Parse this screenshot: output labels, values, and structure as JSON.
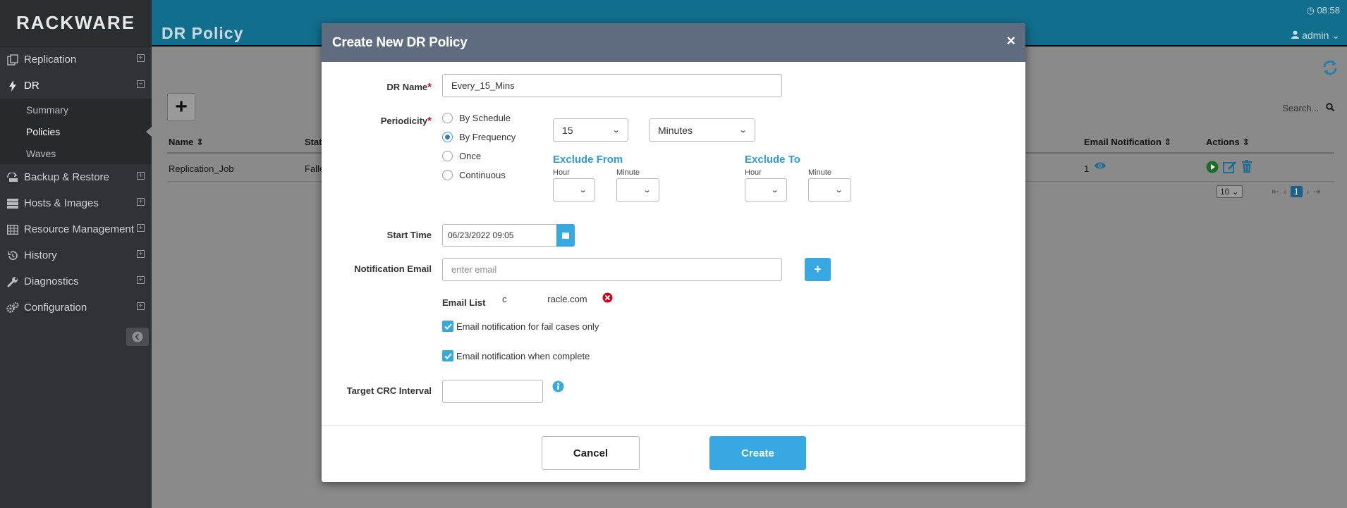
{
  "app": {
    "brand": "RACKWARE",
    "page_title": "DR Policy",
    "clock": "08:58",
    "user": "admin"
  },
  "sidebar": {
    "items": [
      {
        "label": "Replication",
        "icon": "replication-icon"
      },
      {
        "label": "DR",
        "icon": "bolt-icon"
      },
      {
        "label": "Backup & Restore",
        "icon": "backup-icon"
      },
      {
        "label": "Hosts & Images",
        "icon": "server-icon"
      },
      {
        "label": "Resource Management",
        "icon": "grid-icon"
      },
      {
        "label": "History",
        "icon": "history-icon"
      },
      {
        "label": "Diagnostics",
        "icon": "wrench-icon"
      },
      {
        "label": "Configuration",
        "icon": "gears-icon"
      }
    ],
    "dr_subitems": [
      "Summary",
      "Policies",
      "Waves"
    ]
  },
  "table": {
    "search_placeholder": "Search...",
    "columns": {
      "name": "Name",
      "status": "Stat",
      "email_notification": "Email Notification",
      "actions": "Actions"
    },
    "rows": [
      {
        "name": "Replication_Job",
        "status": "Falle",
        "email_count": "1"
      }
    ],
    "page_size": "10",
    "current_page": "1"
  },
  "modal": {
    "title": "Create New DR Policy",
    "close": "×",
    "dr_name_label": "DR Name",
    "dr_name_value": "Every_15_Mins",
    "periodicity_label": "Periodicity",
    "periodicity_options": [
      "By Schedule",
      "By Frequency",
      "Once",
      "Continuous"
    ],
    "periodicity_selected": "By Frequency",
    "frequency_value": "15",
    "frequency_unit": "Minutes",
    "exclude_from_title": "Exclude From",
    "exclude_to_title": "Exclude To",
    "hour_label": "Hour",
    "minute_label": "Minute",
    "start_time_label": "Start Time",
    "start_time_value": "06/23/2022 09:05",
    "notification_email_label": "Notification Email",
    "notification_email_placeholder": "enter email",
    "email_list_label": "Email List",
    "email_list_entry": "c                racle.com",
    "check_fail_only": "Email notification for fail cases only",
    "check_when_complete": "Email notification when complete",
    "target_crc_label": "Target CRC Interval",
    "target_crc_value": "",
    "cancel_label": "Cancel",
    "create_label": "Create"
  },
  "colors": {
    "header_bar": "#116e8c",
    "modal_header": "#5f6c80",
    "accent": "#37a8e2",
    "exclude_title": "#2a9bd6",
    "required": "#d0021b"
  }
}
